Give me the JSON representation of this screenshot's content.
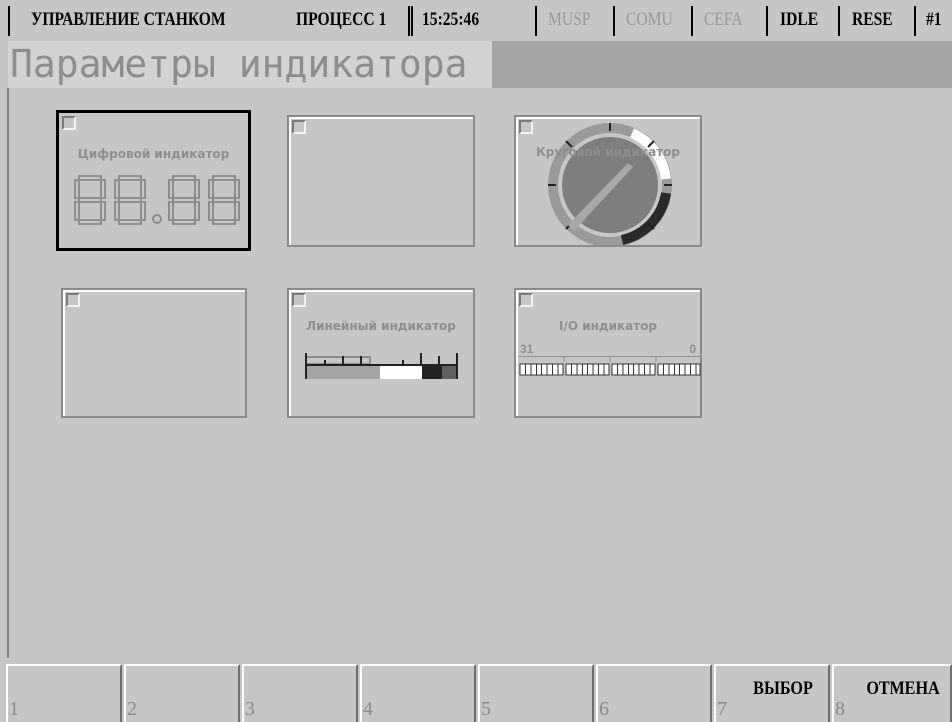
{
  "status": {
    "mode": "УПРАВЛЕНИЕ СТАНКОМ",
    "process": "ПРОЦЕСС 1",
    "time": "15:25:46",
    "flags": [
      "MUSP",
      "COMU",
      "CEFA"
    ],
    "state": "IDLE",
    "reset": "RESE",
    "channel": "#1"
  },
  "page": {
    "title": "Параметры индикатора"
  },
  "tiles": [
    {
      "label": "Цифровой индикатор",
      "digits": "88.88",
      "selected": true
    },
    {
      "label": ""
    },
    {
      "label": "Круговой индикатор"
    },
    {
      "label": ""
    },
    {
      "label": "Линейный индикатор"
    },
    {
      "label": "I/O индикатор",
      "bit_high": "31",
      "bit_low": "0"
    }
  ],
  "softkeys": [
    {
      "num": "1",
      "label": ""
    },
    {
      "num": "2",
      "label": ""
    },
    {
      "num": "3",
      "label": ""
    },
    {
      "num": "4",
      "label": ""
    },
    {
      "num": "5",
      "label": ""
    },
    {
      "num": "6",
      "label": ""
    },
    {
      "num": "7",
      "label": "ВЫБОР"
    },
    {
      "num": "8",
      "label": "ОТМЕНА"
    }
  ],
  "colors": {
    "background": "#c6c6c6",
    "title_bar": "#a4a4a4",
    "title_box": "#d2d2d2",
    "dim_text": "#8e8e8e"
  },
  "icons": [
    "seven-segment-display-icon",
    "circular-gauge-icon",
    "linear-bar-gauge-icon",
    "io-bits-icon"
  ]
}
